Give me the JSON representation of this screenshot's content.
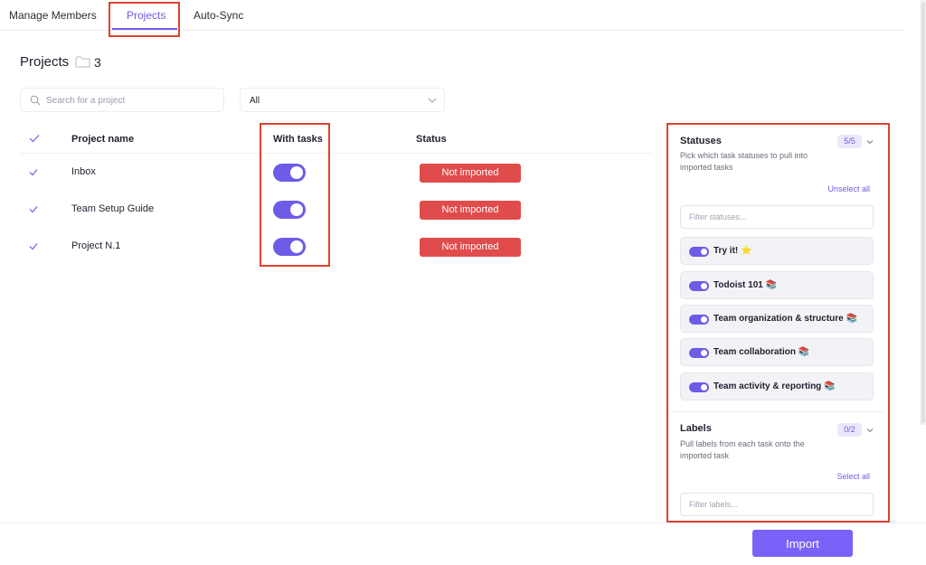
{
  "tabs": [
    {
      "label": "Manage Members"
    },
    {
      "label": "Projects",
      "active": true
    },
    {
      "label": "Auto-Sync"
    }
  ],
  "header": {
    "title": "Projects",
    "count": "3",
    "icon": "folder-icon"
  },
  "search": {
    "placeholder": "Search for a project",
    "value": ""
  },
  "filter": {
    "selected": "All"
  },
  "table": {
    "columns": [
      "Project name",
      "With tasks",
      "Status"
    ],
    "rows": [
      {
        "name": "Inbox",
        "with_tasks": true,
        "status": "Not imported"
      },
      {
        "name": "Team Setup Guide",
        "with_tasks": true,
        "status": "Not imported"
      },
      {
        "name": "Project N.1",
        "with_tasks": true,
        "status": "Not imported"
      }
    ]
  },
  "panel": {
    "statuses": {
      "title": "Statuses",
      "badge": "5/5",
      "description": "Pick which task statuses to pull into imported tasks",
      "action": "Unselect all",
      "filter_placeholder": "Filter statuses...",
      "items": [
        {
          "label": "Try it! ⭐",
          "enabled": true
        },
        {
          "label": "Todoist 101 📚",
          "enabled": true
        },
        {
          "label": "Team organization & structure 📚",
          "enabled": true
        },
        {
          "label": "Team collaboration 📚",
          "enabled": true
        },
        {
          "label": "Team activity & reporting 📚",
          "enabled": true
        }
      ]
    },
    "labels": {
      "title": "Labels",
      "badge": "0/2",
      "description": "Pull labels from each task onto the imported task",
      "action": "Select all",
      "filter_placeholder": "Filter labels..."
    }
  },
  "footer": {
    "import_label": "Import"
  },
  "colors": {
    "accent": "#6c5ce7",
    "status_red": "#e04b4b",
    "import_button": "#7b61f8",
    "highlight_box": "#e0412f"
  }
}
